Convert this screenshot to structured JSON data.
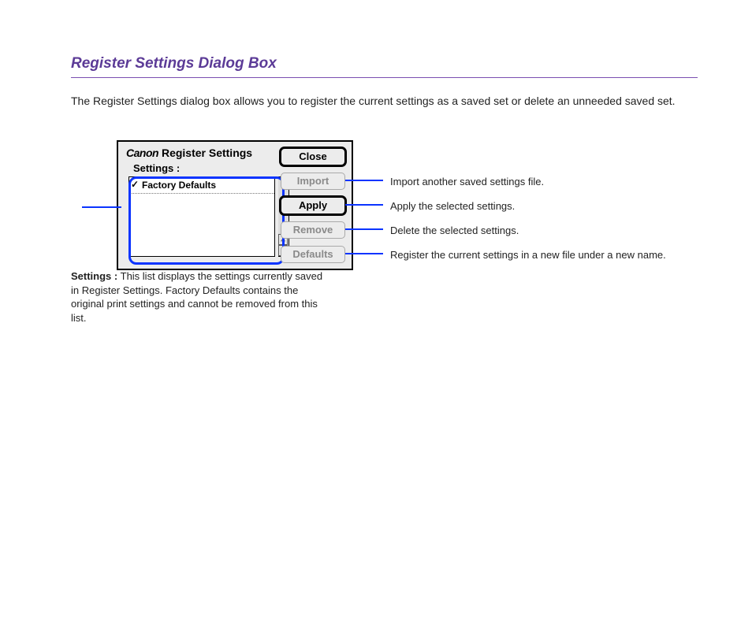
{
  "section": {
    "heading": "Register Settings Dialog Box",
    "intro": "The Register Settings dialog box allows you to register the current settings as a saved set or delete an unneeded saved set."
  },
  "dialog": {
    "brand": "Canon",
    "title": "Register Settings",
    "settings_label": "Settings :",
    "items": [
      {
        "label": "Factory Defaults",
        "checked": true
      }
    ],
    "buttons": {
      "close": "Close",
      "import": "Import",
      "apply": "Apply",
      "remove": "Remove",
      "defaults": "Defaults"
    }
  },
  "callouts": {
    "import": "Import another saved settings file.",
    "apply": "Apply the selected settings.",
    "remove": "Delete the selected settings.",
    "defaults": "Register the current settings in a new file under a new name.",
    "settings": "This list displays the settings currently saved in Register Settings. Factory Defaults contains the original print settings and cannot be removed from this list."
  }
}
